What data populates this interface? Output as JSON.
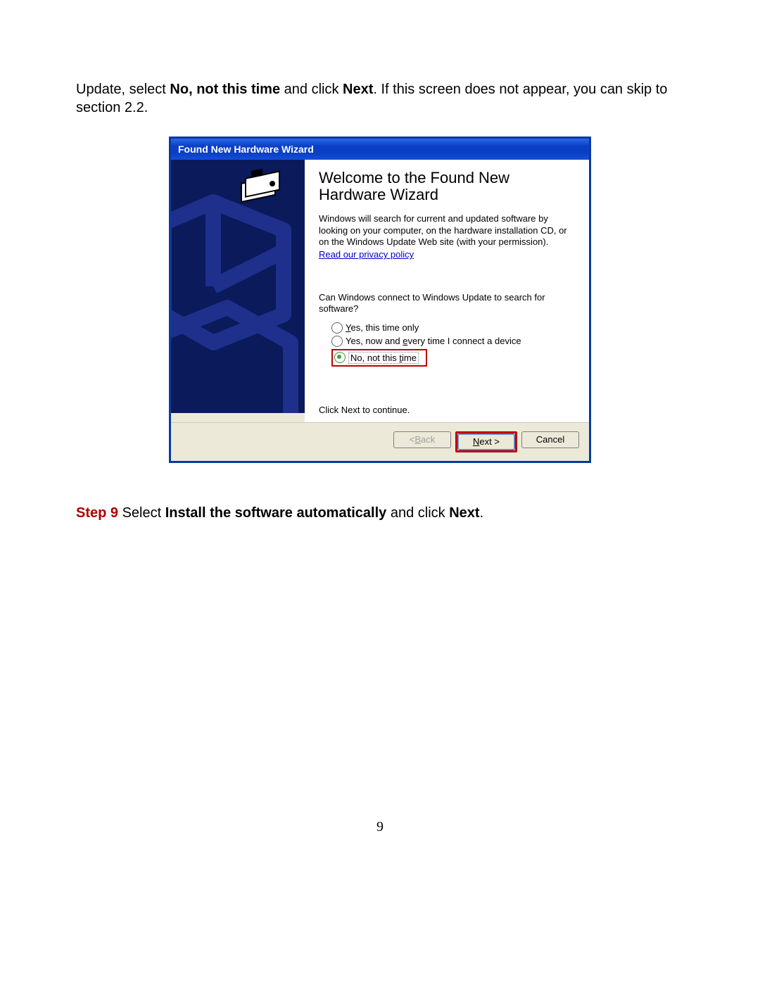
{
  "intro": {
    "prefix": "Update, select ",
    "bold1": "No, not this time",
    "mid": " and click ",
    "bold2": "Next",
    "suffix": ". If this screen does not appear, you can skip to section 2.2."
  },
  "wizard": {
    "title": "Found New Hardware Wizard",
    "welcome": "Welcome to the Found New Hardware Wizard",
    "desc": "Windows will search for current and updated software by looking on your computer, on the hardware installation CD, or on the Windows Update Web site (with your permission).",
    "privacy": "Read our privacy policy",
    "question": "Can Windows connect to Windows Update to search for software?",
    "options": [
      {
        "pre": "",
        "acc": "Y",
        "post": "es, this time only",
        "selected": false,
        "highlight": false
      },
      {
        "pre": "Yes, now and ",
        "acc": "e",
        "post": "very time I connect a device",
        "selected": false,
        "highlight": false
      },
      {
        "pre": "No, not this ",
        "acc": "t",
        "post": "ime",
        "selected": true,
        "highlight": true
      }
    ],
    "click_next": "Click Next to continue.",
    "buttons": {
      "back": {
        "pre": "< ",
        "acc": "B",
        "post": "ack"
      },
      "next": {
        "pre": "",
        "acc": "N",
        "post": "ext >"
      },
      "cancel": "Cancel"
    }
  },
  "step9": {
    "label": "Step 9",
    "pre": " Select ",
    "bold1": "Install the software automatically",
    "mid": " and click ",
    "bold2": "Next",
    "post": "."
  },
  "page_number": "9"
}
